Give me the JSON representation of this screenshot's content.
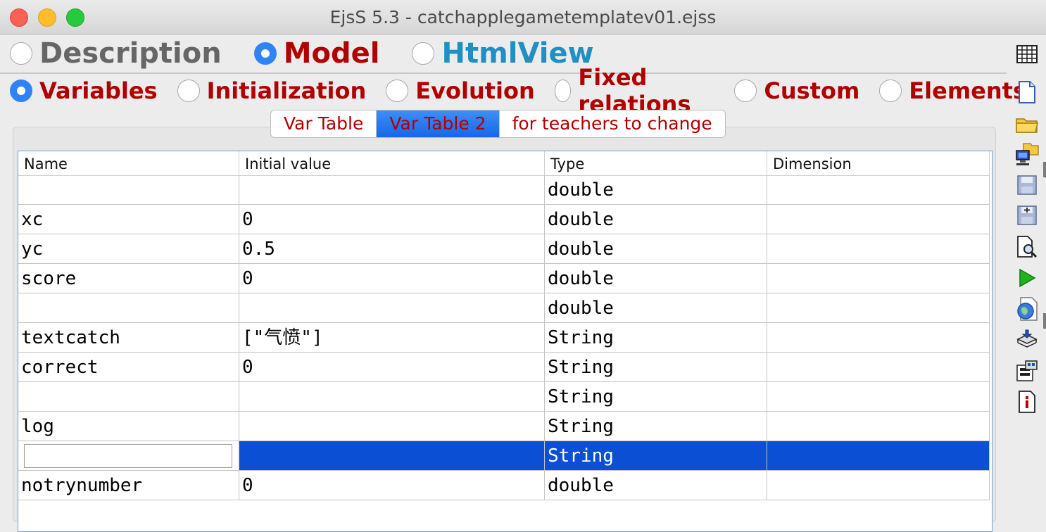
{
  "window": {
    "title": "EjsS 5.3 - catchapplegametemplatev01.ejss"
  },
  "main_tabs": [
    {
      "label": "Description",
      "selected": false
    },
    {
      "label": "Model",
      "selected": true
    },
    {
      "label": "HtmlView",
      "selected": false
    }
  ],
  "model_tabs": [
    {
      "label": "Variables",
      "selected": true
    },
    {
      "label": "Initialization",
      "selected": false
    },
    {
      "label": "Evolution",
      "selected": false
    },
    {
      "label": "Fixed relations",
      "selected": false
    },
    {
      "label": "Custom",
      "selected": false
    },
    {
      "label": "Elements",
      "selected": false
    }
  ],
  "var_pages": [
    {
      "label": "Var Table",
      "active": false
    },
    {
      "label": "Var Table 2",
      "active": true
    },
    {
      "label": "for teachers to change",
      "active": false
    }
  ],
  "table": {
    "columns": [
      "Name",
      "Initial value",
      "Type",
      "Dimension"
    ],
    "rows": [
      {
        "name": "",
        "value": "",
        "type": "double",
        "dim": ""
      },
      {
        "name": "xc",
        "value": "0",
        "type": "double",
        "dim": ""
      },
      {
        "name": "yc",
        "value": "0.5",
        "type": "double",
        "dim": ""
      },
      {
        "name": "score",
        "value": "0",
        "type": "double",
        "dim": ""
      },
      {
        "name": "",
        "value": "",
        "type": "double",
        "dim": ""
      },
      {
        "name": "textcatch",
        "value": "[\"气愤\"]",
        "type": "String",
        "dim": ""
      },
      {
        "name": "correct",
        "value": "0",
        "type": "String",
        "dim": ""
      },
      {
        "name": "",
        "value": "",
        "type": "String",
        "dim": ""
      },
      {
        "name": "log",
        "value": "",
        "type": "String",
        "dim": ""
      },
      {
        "name": "",
        "value": "",
        "type": "String",
        "dim": "",
        "selected": true
      },
      {
        "name": "notrynumber",
        "value": "0",
        "type": "double",
        "dim": ""
      }
    ]
  },
  "toolbar_icons": [
    "table-options-icon",
    "new-file-icon",
    "open-folder-icon",
    "open-remote-icon",
    "save-icon",
    "save-as-icon",
    "search-icon",
    "run-icon",
    "web-icon",
    "package-icon",
    "preferences-icon",
    "info-icon"
  ]
}
